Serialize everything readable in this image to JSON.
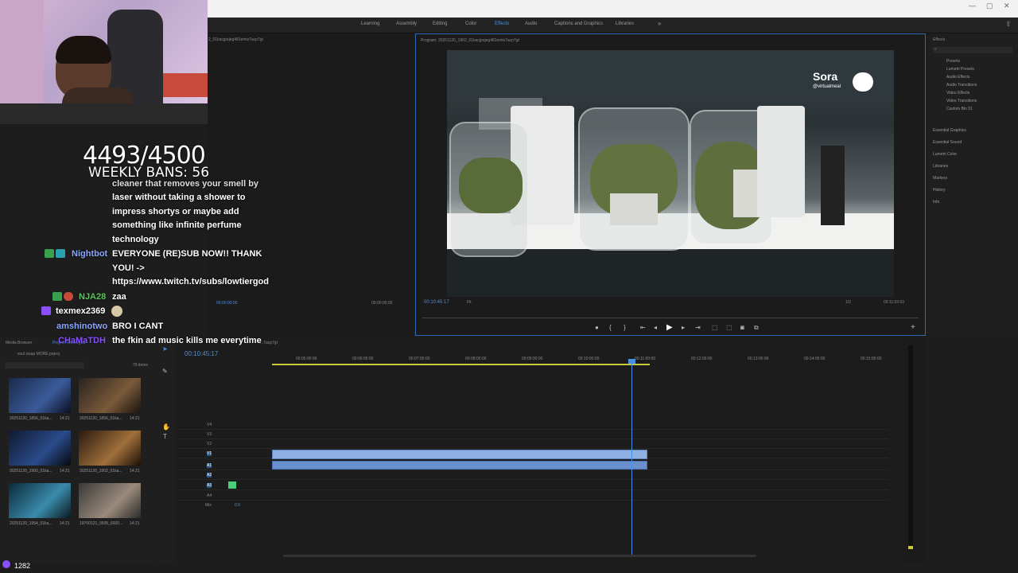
{
  "workspaces": [
    "Learning",
    "Assembly",
    "Editing",
    "Color",
    "Effects",
    "Audio",
    "Captions and Graphics",
    "Libraries"
  ],
  "source_monitor": {
    "title": "2_01kacjpojeg481emiv7acp7gt",
    "timecode_left": "00;00;00;00",
    "timecode_right": "00;00;00;00"
  },
  "program_monitor": {
    "title": "Program: 20251120_1902_01kacjpojeg481emiv7acp7gt",
    "timecode": "00:10:45:17",
    "fit": "Fit",
    "ratio": "1/2",
    "duration": "00:11:03:03",
    "watermark": "Sora",
    "watermark_handle": "@virtualmeal"
  },
  "effects_panel": {
    "title": "Effects",
    "tree": [
      "Presets",
      "Lumetri Presets",
      "Audio Effects",
      "Audio Transitions",
      "Video Effects",
      "Video Transitions",
      "Custom Bin 01"
    ],
    "sections": [
      "Essential Graphics",
      "Essential Sound",
      "Lumetri Color",
      "Libraries",
      "Markers",
      "History",
      "Info"
    ]
  },
  "project_panel": {
    "tabs": [
      "Media Browser",
      "Project: lowtiergod"
    ],
    "file": "soul swap MORE.prproj",
    "count": "79 items",
    "items": [
      {
        "name": "20251120_1856_01ka...",
        "dur": "14:21"
      },
      {
        "name": "20251120_1856_01ka...",
        "dur": "14:21"
      },
      {
        "name": "20251120_1900_01ka...",
        "dur": "14:21"
      },
      {
        "name": "20251120_1902_01ka...",
        "dur": "14:21"
      },
      {
        "name": "20251120_1954_01ka...",
        "dur": "14:21"
      },
      {
        "name": "19700121_0505_6920...",
        "dur": "14:21"
      }
    ]
  },
  "timeline": {
    "title": "...7acp7gt",
    "timecode": "00:10:45:17",
    "ruler": [
      "00:05:00:00",
      "00:06:00:00",
      "00:07:00:00",
      "00:08:00:00",
      "00:09:00:00",
      "00:10:00:00",
      "00:11:00:00",
      "00:12:00:00",
      "00:13:00:00",
      "00:14:00:00",
      "00:15:00:00"
    ],
    "video_tracks": [
      "V4",
      "V3",
      "V2",
      "V1"
    ],
    "audio_tracks": [
      "A1",
      "A2",
      "A3",
      "A4"
    ],
    "mix_label": "Mix",
    "mix_value": "0.0"
  },
  "overlay": {
    "counter": "4493/4500",
    "bans": "WEEKLY BANS: 56"
  },
  "chat": [
    {
      "user": "",
      "text": "cleaner that removes your smell by"
    },
    {
      "user": "",
      "text": "laser without taking a shower to"
    },
    {
      "user": "",
      "text": "impress shortys or maybe add"
    },
    {
      "user": "",
      "text": "something like infinite perfume"
    },
    {
      "user": "",
      "text": "technology"
    },
    {
      "user": "Nightbot",
      "text": "EVERYONE (RE)SUB NOW!! THANK"
    },
    {
      "user": "",
      "text": "YOU! ->"
    },
    {
      "user": "",
      "text": "https://www.twitch.tv/subs/lowtiergod"
    },
    {
      "user": "NJA28",
      "text": "zaa"
    },
    {
      "user": "texmex2369",
      "text": ""
    },
    {
      "user": "amshinotwo",
      "text": "BRO I CANT"
    },
    {
      "user": "CHaMaTDH",
      "text": "the fkin ad music kills me everytime"
    }
  ],
  "status": {
    "count": "1282"
  },
  "colors": {
    "accent": "#4a90e2",
    "nightbot": "#8aa7ff",
    "nja": "#5bc85b",
    "amshino": "#8aa7ff",
    "chamat": "#8a4fff"
  }
}
